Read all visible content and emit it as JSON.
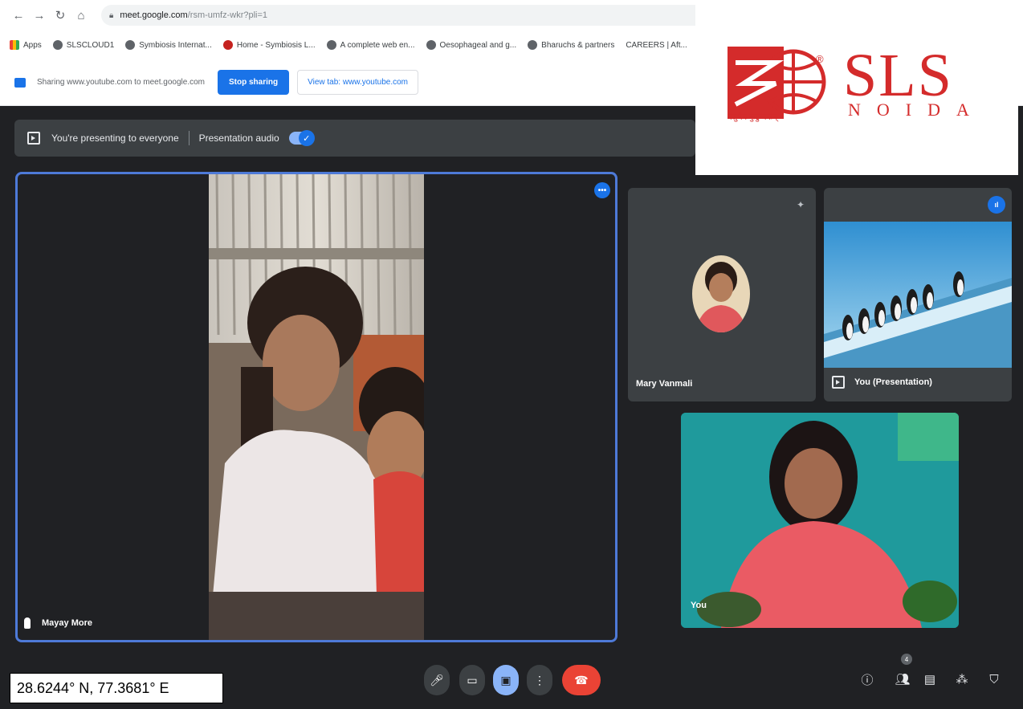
{
  "browser": {
    "url_host": "meet.google.com",
    "url_path": "/rsm-umfz-wkr?pli=1",
    "bookmarks": [
      "Apps",
      "SLSCLOUD1",
      "Symbiosis Internat...",
      "Home - Symbiosis L...",
      "A complete web en...",
      "Oesophageal and g...",
      "Bharuchs & partners",
      "CAREERS | Aft..."
    ]
  },
  "share_bar": {
    "message": "Sharing www.youtube.com to meet.google.com",
    "stop_label": "Stop sharing",
    "view_tab_label": "View tab: www.youtube.com"
  },
  "meet": {
    "presenting_text": "You're presenting to everyone",
    "presentation_audio_label": "Presentation audio",
    "presentation_audio_on": true,
    "main_tile_name": "Mayay More",
    "tiles": [
      {
        "name": "Mary Vanmali"
      },
      {
        "name": "You (Presentation)"
      },
      {
        "name": "You"
      }
    ],
    "participants_count": "4"
  },
  "logo": {
    "text": "SLS",
    "sub": "NOIDA",
    "tagline": "वसुधैव कुटुम्बकम्"
  },
  "overlay": {
    "coordinates": "28.6244° N, 77.3681° E"
  },
  "colors": {
    "accent": "#1a73e8",
    "meet_bg": "#202124",
    "end_call": "#ea4335",
    "logo_red": "#d42b2b"
  }
}
